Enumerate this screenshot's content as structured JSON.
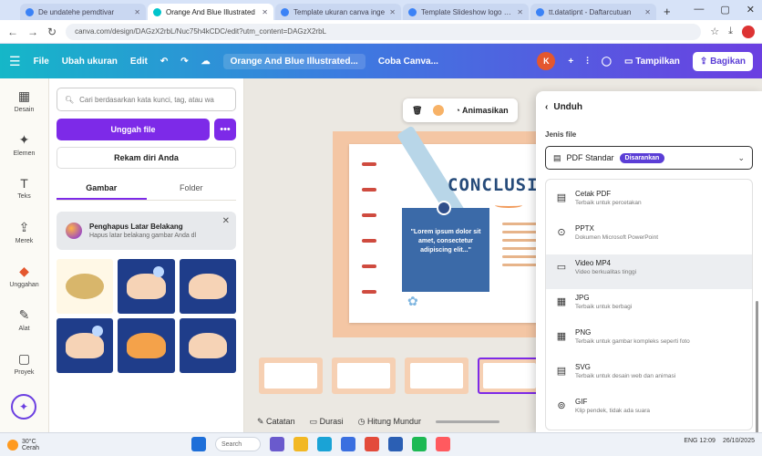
{
  "browser": {
    "tabs": [
      {
        "label": "De undatehe pemdtivar"
      },
      {
        "label": "Orange And Blue Illustrated"
      },
      {
        "label": "Template ukuran canva inge"
      },
      {
        "label": "Template Slideshow logo cus"
      },
      {
        "label": "tt.datatipnt - Daftarcutuan"
      }
    ],
    "address": "canva.com/design/DAGzX2rbL/Nuc75h4kCDC/edit?utm_content=DAGzX2rbL",
    "new_tab": "+"
  },
  "header": {
    "menu_icon": "☰",
    "file_label": "File",
    "resize_label": "Ubah ukuran",
    "edit_label": "Edit",
    "title": "Orange And Blue Illustrated...",
    "home_label": "Coba Canva...",
    "user_initial": "K",
    "present_label": "Tampilkan",
    "share_label": "Bagikan"
  },
  "rail": {
    "items": [
      {
        "icon": "▦",
        "label": "Desain"
      },
      {
        "icon": "✦",
        "label": "Elemen"
      },
      {
        "icon": "T",
        "label": "Teks"
      },
      {
        "icon": "⇪",
        "label": "Merek"
      },
      {
        "icon": "◆",
        "label": "Unggahan"
      },
      {
        "icon": "✎",
        "label": "Alat"
      },
      {
        "icon": "▢",
        "label": "Proyek"
      }
    ],
    "bottom_icon": "✦"
  },
  "panel": {
    "search_placeholder": "Cari berdasarkan kata kunci, tag, atau wa",
    "upload_label": "Unggah file",
    "more_label": "•••",
    "record_label": "Rekam diri Anda",
    "tabs": [
      "Gambar",
      "Folder"
    ],
    "promo_title": "Penghapus Latar Belakang",
    "promo_sub": "Hapus latar belakang gambar Anda dl",
    "promo_close": "✕"
  },
  "canvas": {
    "ctx_animate": "Animasikan",
    "ctx_trash": "🗑",
    "heading": "CONCLUSI",
    "note_text": "\"Lorem ipsum dolor sit amet, consectetur adipiscing elit...\"",
    "flower": "✿"
  },
  "bottom_bar": {
    "notes": "Catatan",
    "duration": "Durasi",
    "timer": "Hitung Mundur"
  },
  "download": {
    "back_label": "Unduh",
    "type_label": "Jenis file",
    "selected": "PDF Standar",
    "selected_badge": "Disarankan",
    "options": [
      {
        "icon": "▤",
        "title": "Cetak PDF",
        "sub": "Terbaik untuk percetakan"
      },
      {
        "icon": "⊙",
        "title": "PPTX",
        "sub": "Dokumen Microsoft PowerPoint"
      },
      {
        "icon": "▭",
        "title": "Video MP4",
        "sub": "Video berkualitas tinggi"
      },
      {
        "icon": "▦",
        "title": "JPG",
        "sub": "Terbaik untuk berbagi"
      },
      {
        "icon": "▦",
        "title": "PNG",
        "sub": "Terbaik untuk gambar kompleks seperti foto"
      },
      {
        "icon": "▤",
        "title": "SVG",
        "sub": "Terbaik untuk desain web dan animasi"
      },
      {
        "icon": "⊚",
        "title": "GIF",
        "sub": "Klip pendek, tidak ada suara"
      }
    ]
  },
  "taskbar": {
    "weather_temp": "30°C",
    "weather_desc": "Cerah",
    "search_label": "Search",
    "tray": "ENG  12:09",
    "tray_date": "26/10/2025"
  },
  "colors": {
    "accent": "#7d2ae8",
    "brand_gradient_start": "#15b7c8",
    "brand_gradient_end": "#6b3fe1"
  }
}
